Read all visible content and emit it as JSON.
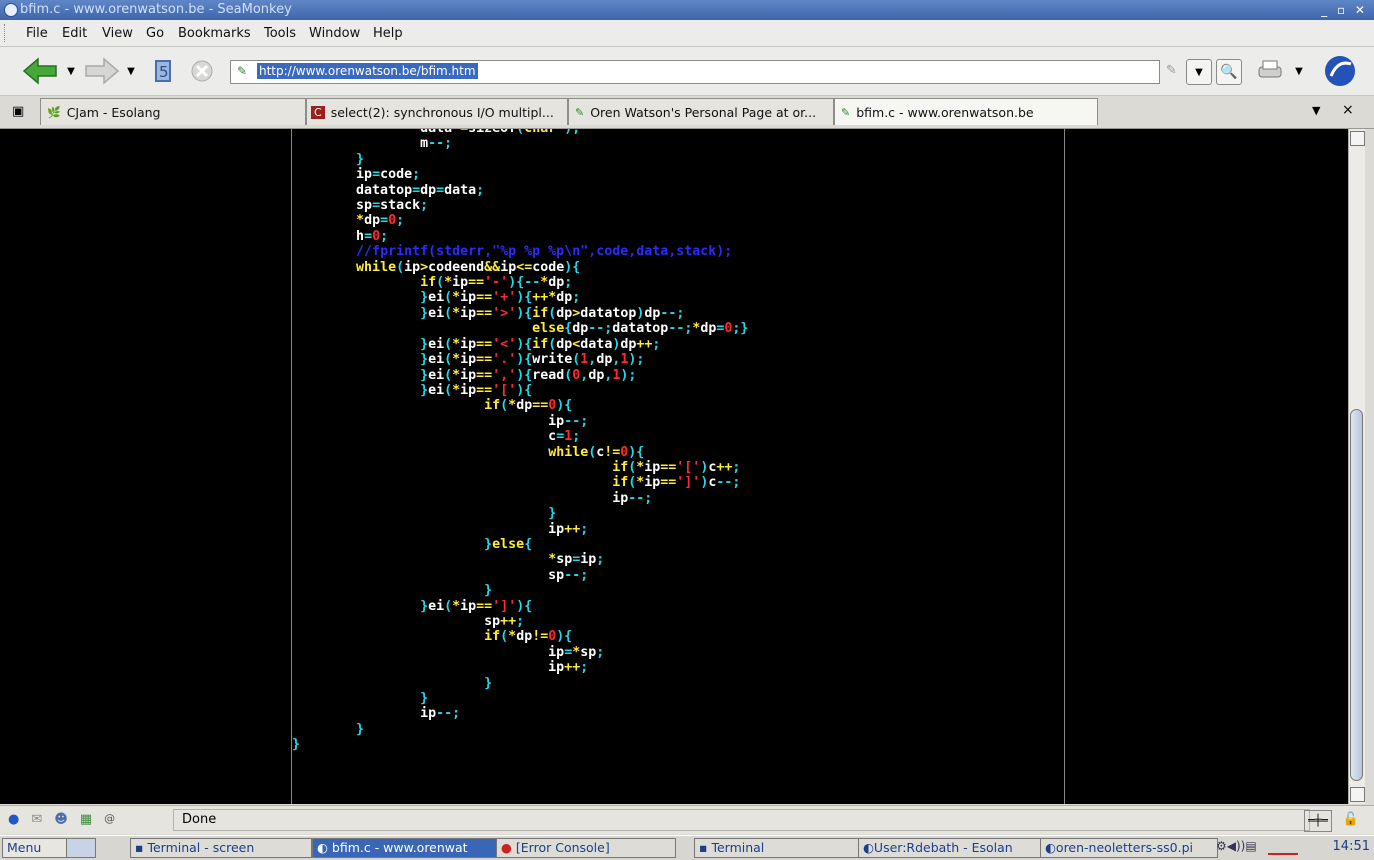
{
  "window": {
    "title": "bfim.c - www.orenwatson.be - SeaMonkey",
    "controls": "_ ▫ ✕"
  },
  "menu": [
    "File",
    "Edit",
    "View",
    "Go",
    "Bookmarks",
    "Tools",
    "Window",
    "Help"
  ],
  "nav": {
    "url": "http://www.orenwatson.be/bfim.htm"
  },
  "tabs": [
    {
      "label": "CJam - Esolang"
    },
    {
      "label": "select(2): synchronous I/O multipl..."
    },
    {
      "label": "Oren Watson's Personal Page at or..."
    },
    {
      "label": "bfim.c - www.orenwatson.be"
    }
  ],
  "status": {
    "text": "Done"
  },
  "taskbar": {
    "menu": "Menu",
    "items": [
      "Terminal - screen",
      "bfim.c - www.orenwat",
      "[Error Console]",
      "Terminal",
      "User:Rdebath - Esolan",
      "oren-neoletters-ss0.pi"
    ],
    "clock": "14:51"
  },
  "colors": {
    "code_bg": "#000000",
    "keyword": "#ffeb3b",
    "punct": "#25d8e8",
    "number": "#ff2b2b",
    "comment": "#2b2bff"
  }
}
